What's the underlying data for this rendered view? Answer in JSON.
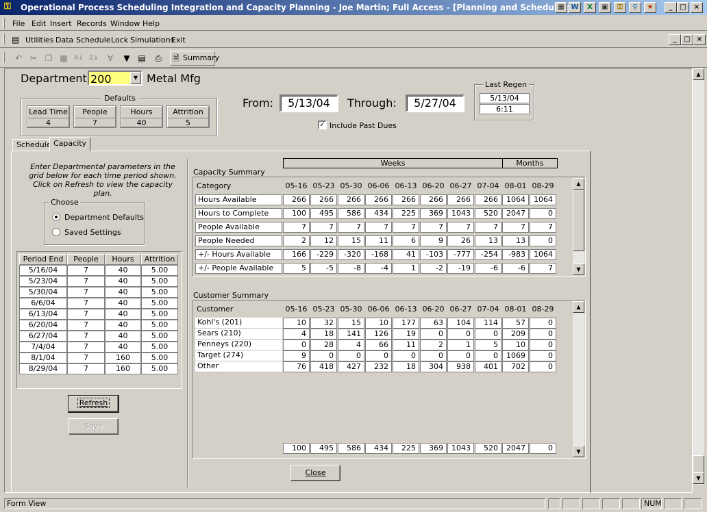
{
  "window": {
    "title": "Operational Process Scheduling Integration and Capacity Planning - Joe Martin; Full Access - [Planning and Scheduling]",
    "title_controls": [
      "_",
      "□",
      "×"
    ],
    "inner_controls": [
      "_",
      "□",
      "×"
    ]
  },
  "menu": [
    "File",
    "Edit",
    "Insert",
    "Records",
    "Window",
    "Help"
  ],
  "menu2": [
    "Utilities",
    "Data",
    "Schedule",
    "Lock",
    "Simulations",
    "Exit"
  ],
  "toolbar": {
    "summary_label": "Summary"
  },
  "dept": {
    "label": "Department",
    "code": "200",
    "name": "Metal Mfg"
  },
  "defaults": {
    "title": "Defaults",
    "items": [
      {
        "label": "Lead Time",
        "value": "4"
      },
      {
        "label": "People",
        "value": "7"
      },
      {
        "label": "Hours",
        "value": "40"
      },
      {
        "label": "Attrition",
        "value": "5"
      }
    ]
  },
  "range": {
    "from_label": "From:",
    "from": "5/13/04",
    "through_label": "Through:",
    "through": "5/27/04",
    "include_past_dues": "Include Past Dues"
  },
  "last_regen": {
    "title": "Last Regen",
    "date": "5/13/04",
    "time": "6:11"
  },
  "tabs": [
    "Schedule",
    "Capacity"
  ],
  "instructions": "Enter Departmental parameters in the grid below for each time period shown. Click on Refresh to view the capacity plan.",
  "choose": {
    "title": "Choose",
    "options": [
      "Department Defaults",
      "Saved Settings"
    ]
  },
  "periods": {
    "headers": [
      "Period End",
      "People",
      "Hours",
      "Attrition"
    ],
    "rows": [
      [
        "5/16/04",
        "7",
        "40",
        "5.00"
      ],
      [
        "5/23/04",
        "7",
        "40",
        "5.00"
      ],
      [
        "5/30/04",
        "7",
        "40",
        "5.00"
      ],
      [
        "6/6/04",
        "7",
        "40",
        "5.00"
      ],
      [
        "6/13/04",
        "7",
        "40",
        "5.00"
      ],
      [
        "6/20/04",
        "7",
        "40",
        "5.00"
      ],
      [
        "6/27/04",
        "7",
        "40",
        "5.00"
      ],
      [
        "7/4/04",
        "7",
        "40",
        "5.00"
      ],
      [
        "8/1/04",
        "7",
        "160",
        "5.00"
      ],
      [
        "8/29/04",
        "7",
        "160",
        "5.00"
      ]
    ]
  },
  "buttons": {
    "refresh": "Refresh",
    "save": "Save",
    "close": "Close"
  },
  "group_headers": {
    "weeks": "Weeks",
    "months": "Months"
  },
  "columns": [
    "05-16",
    "05-23",
    "05-30",
    "06-06",
    "06-13",
    "06-20",
    "06-27",
    "07-04",
    "08-01",
    "08-29"
  ],
  "capacity": {
    "title": "Capacity Summary",
    "col_label": "Category",
    "rows": [
      {
        "name": "Hours Available",
        "values": [
          "266",
          "266",
          "266",
          "266",
          "266",
          "266",
          "266",
          "266",
          "1064",
          "1064"
        ]
      },
      {
        "name": "Hours to Complete",
        "values": [
          "100",
          "495",
          "586",
          "434",
          "225",
          "369",
          "1043",
          "520",
          "2047",
          "0"
        ]
      },
      {
        "name": "People Available",
        "values": [
          "7",
          "7",
          "7",
          "7",
          "7",
          "7",
          "7",
          "7",
          "7",
          "7"
        ]
      },
      {
        "name": "People Needed",
        "values": [
          "2",
          "12",
          "15",
          "11",
          "6",
          "9",
          "26",
          "13",
          "13",
          "0"
        ]
      },
      {
        "name": "+/- Hours Available",
        "values": [
          "166",
          "-229",
          "-320",
          "-168",
          "41",
          "-103",
          "-777",
          "-254",
          "-983",
          "1064"
        ]
      },
      {
        "name": "+/- People Available",
        "values": [
          "5",
          "-5",
          "-8",
          "-4",
          "1",
          "-2",
          "-19",
          "-6",
          "-6",
          "7"
        ]
      }
    ]
  },
  "customer": {
    "title": "Customer Summary",
    "col_label": "Customer",
    "rows": [
      {
        "name": "Kohl's (201)",
        "values": [
          "10",
          "32",
          "15",
          "10",
          "177",
          "63",
          "104",
          "114",
          "57",
          "0"
        ]
      },
      {
        "name": "Sears (210)",
        "values": [
          "4",
          "18",
          "141",
          "126",
          "19",
          "0",
          "0",
          "0",
          "209",
          "0"
        ]
      },
      {
        "name": "Penneys (220)",
        "values": [
          "0",
          "28",
          "4",
          "66",
          "11",
          "2",
          "1",
          "5",
          "10",
          "0"
        ]
      },
      {
        "name": "Target (274)",
        "values": [
          "9",
          "0",
          "0",
          "0",
          "0",
          "0",
          "0",
          "0",
          "1069",
          "0"
        ]
      },
      {
        "name": "Other",
        "values": [
          "76",
          "418",
          "427",
          "232",
          "18",
          "304",
          "938",
          "401",
          "702",
          "0"
        ]
      }
    ],
    "totals": [
      "100",
      "495",
      "586",
      "434",
      "225",
      "369",
      "1043",
      "520",
      "2047",
      "0"
    ]
  },
  "status": {
    "left": "Form View",
    "num": "NUM"
  }
}
